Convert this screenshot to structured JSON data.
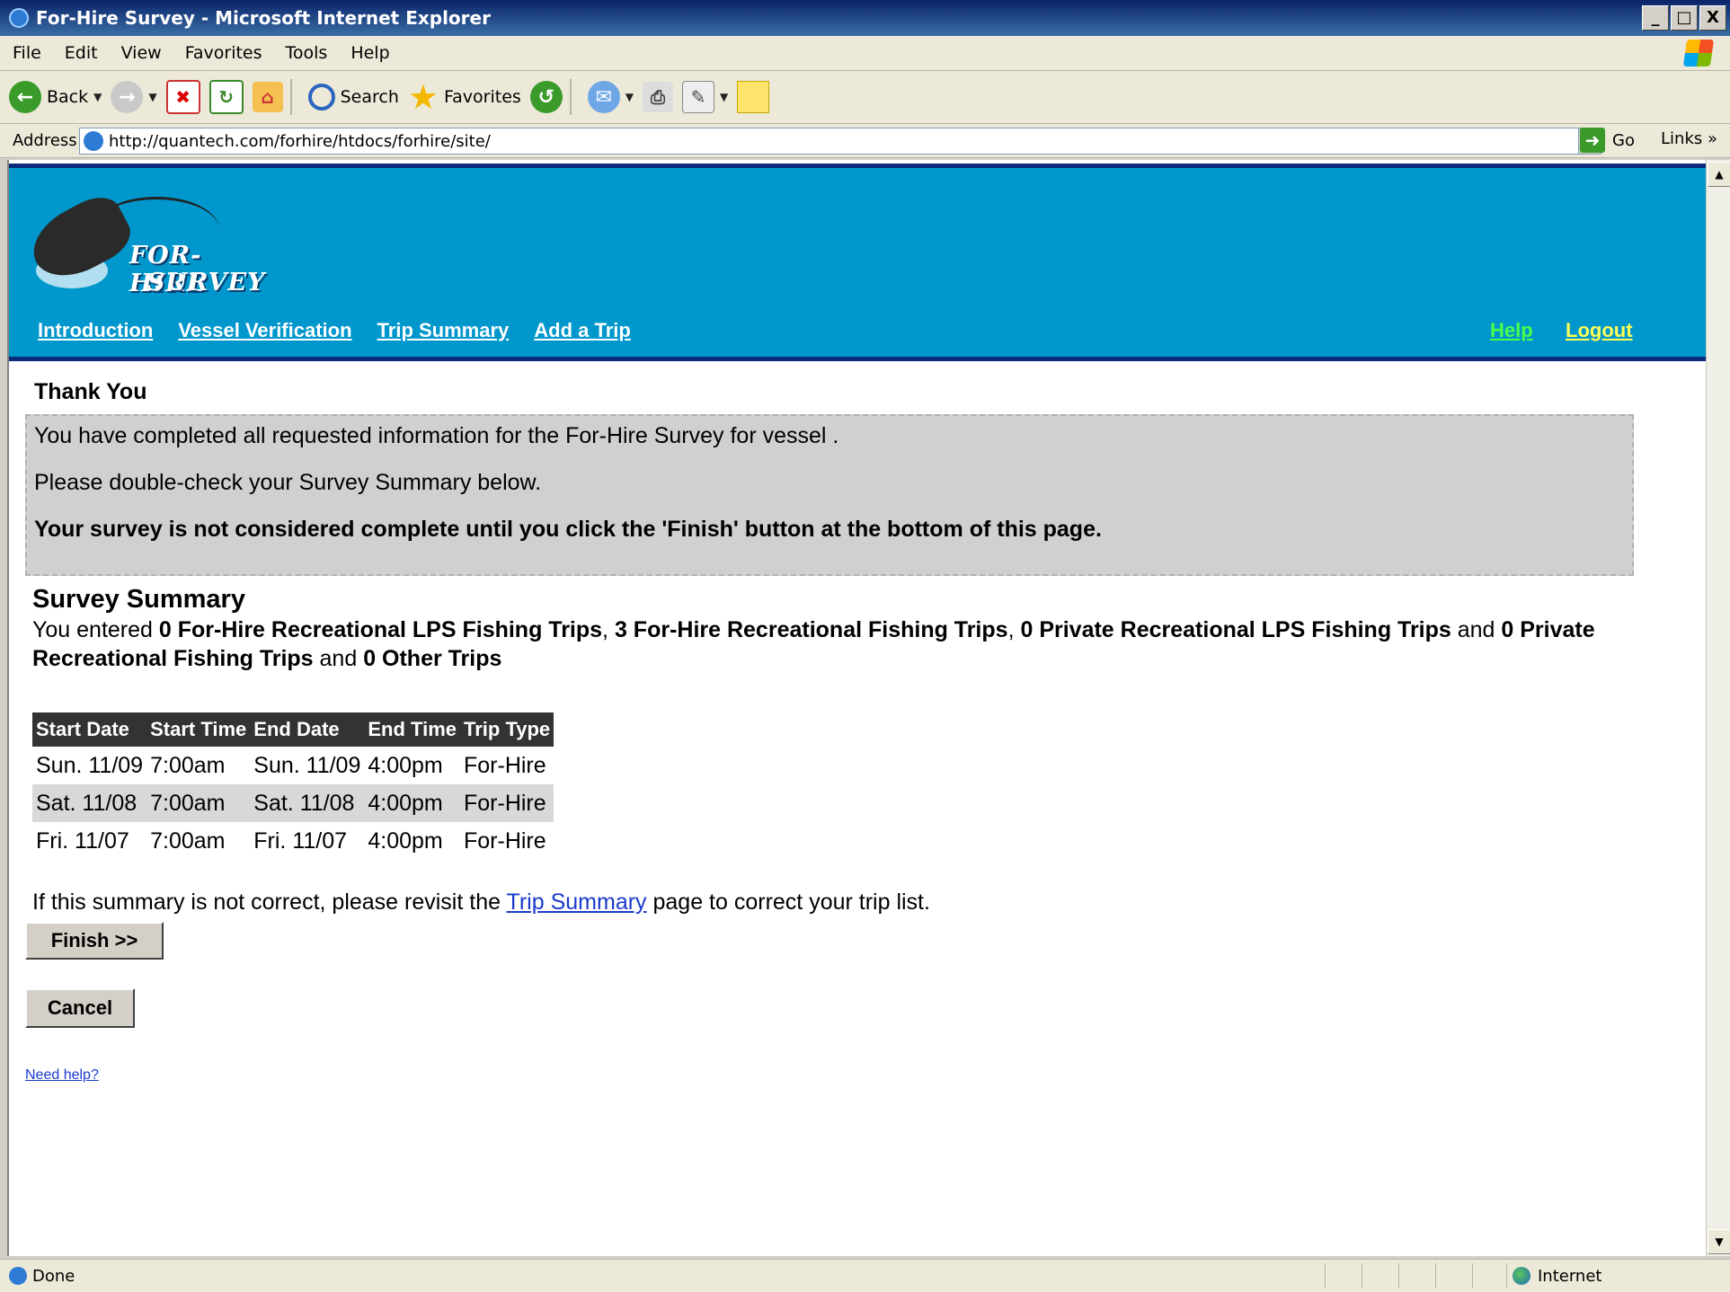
{
  "window": {
    "title": "For-Hire Survey - Microsoft Internet Explorer",
    "min": "_",
    "max": "□",
    "close": "X"
  },
  "menu": [
    "File",
    "Edit",
    "View",
    "Favorites",
    "Tools",
    "Help"
  ],
  "toolbar": {
    "back": "Back",
    "search": "Search",
    "favorites": "Favorites"
  },
  "address": {
    "label": "Address",
    "url": "http://quantech.com/forhire/htdocs/forhire/site/",
    "go": "Go",
    "links": "Links"
  },
  "site": {
    "logo_line1": "FOR-HIRE",
    "logo_line2": "SURVEY",
    "nav": [
      "Introduction",
      "Vessel Verification",
      "Trip Summary",
      "Add a Trip"
    ],
    "help": "Help",
    "logout": "Logout"
  },
  "page": {
    "thanks_heading": "Thank You",
    "notice_line1": "You have completed all requested information for the For-Hire Survey for vessel .",
    "notice_line2": "Please double-check your Survey Summary below.",
    "notice_line3": "Your survey is not considered complete until you click the 'Finish' button at the bottom of this page.",
    "summary_heading": "Survey Summary",
    "summary": {
      "prefix": "You entered ",
      "item1": "0 For-Hire Recreational LPS Fishing Trips",
      "sep1": ", ",
      "item2": "3 For-Hire Recreational Fishing Trips",
      "sep2": ", ",
      "item3": "0 Private Recreational LPS Fishing Trips",
      "sep3": " and ",
      "item4": "0 Private Recreational Fishing Trips",
      "sep4": " and ",
      "item5": "0 Other Trips"
    },
    "table": {
      "headers": [
        "Start Date",
        "Start Time",
        "End Date",
        "End Time",
        "Trip Type"
      ],
      "rows": [
        [
          "Sun. 11/09",
          "7:00am",
          "Sun. 11/09",
          "4:00pm",
          "For-Hire"
        ],
        [
          "Sat. 11/08",
          "7:00am",
          "Sat. 11/08",
          "4:00pm",
          "For-Hire"
        ],
        [
          "Fri. 11/07",
          "7:00am",
          "Fri. 11/07",
          "4:00pm",
          "For-Hire"
        ]
      ]
    },
    "correct_prefix": "If this summary is not correct, please revisit the ",
    "correct_link": "Trip Summary",
    "correct_suffix": " page to correct your trip list.",
    "finish": "Finish >>",
    "cancel": "Cancel",
    "need_help": "Need help?"
  },
  "status": {
    "text": "Done",
    "zone": "Internet"
  }
}
